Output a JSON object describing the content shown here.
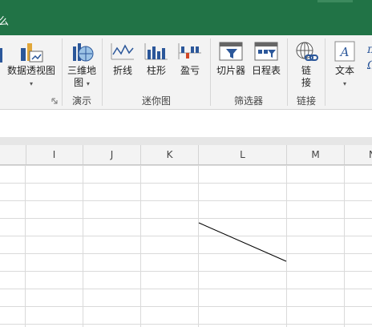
{
  "titlebar": {
    "text": "么"
  },
  "ribbon": {
    "pivot_chart": {
      "label": "数据透视图"
    },
    "map3d": {
      "label_line1": "三维地",
      "label_line2": "图"
    },
    "group_tours": "演示",
    "sparkline_line": {
      "label": "折线"
    },
    "sparkline_column": {
      "label": "柱形"
    },
    "sparkline_winloss": {
      "label": "盈亏"
    },
    "group_sparklines": "迷你图",
    "slicer": {
      "label": "切片器"
    },
    "timeline": {
      "label": "日程表"
    },
    "group_filters": "筛选器",
    "link": {
      "label_line1": "链",
      "label_line2": "接"
    },
    "group_links": "链接",
    "text": {
      "label": "文本"
    },
    "colors": {
      "accent": "#217346",
      "icon_blue": "#2b579a",
      "icon_gold": "#e1a73a",
      "icon_orange": "#d24726"
    }
  },
  "sheet": {
    "columns": [
      "I",
      "J",
      "K",
      "L",
      "M",
      "N"
    ]
  }
}
